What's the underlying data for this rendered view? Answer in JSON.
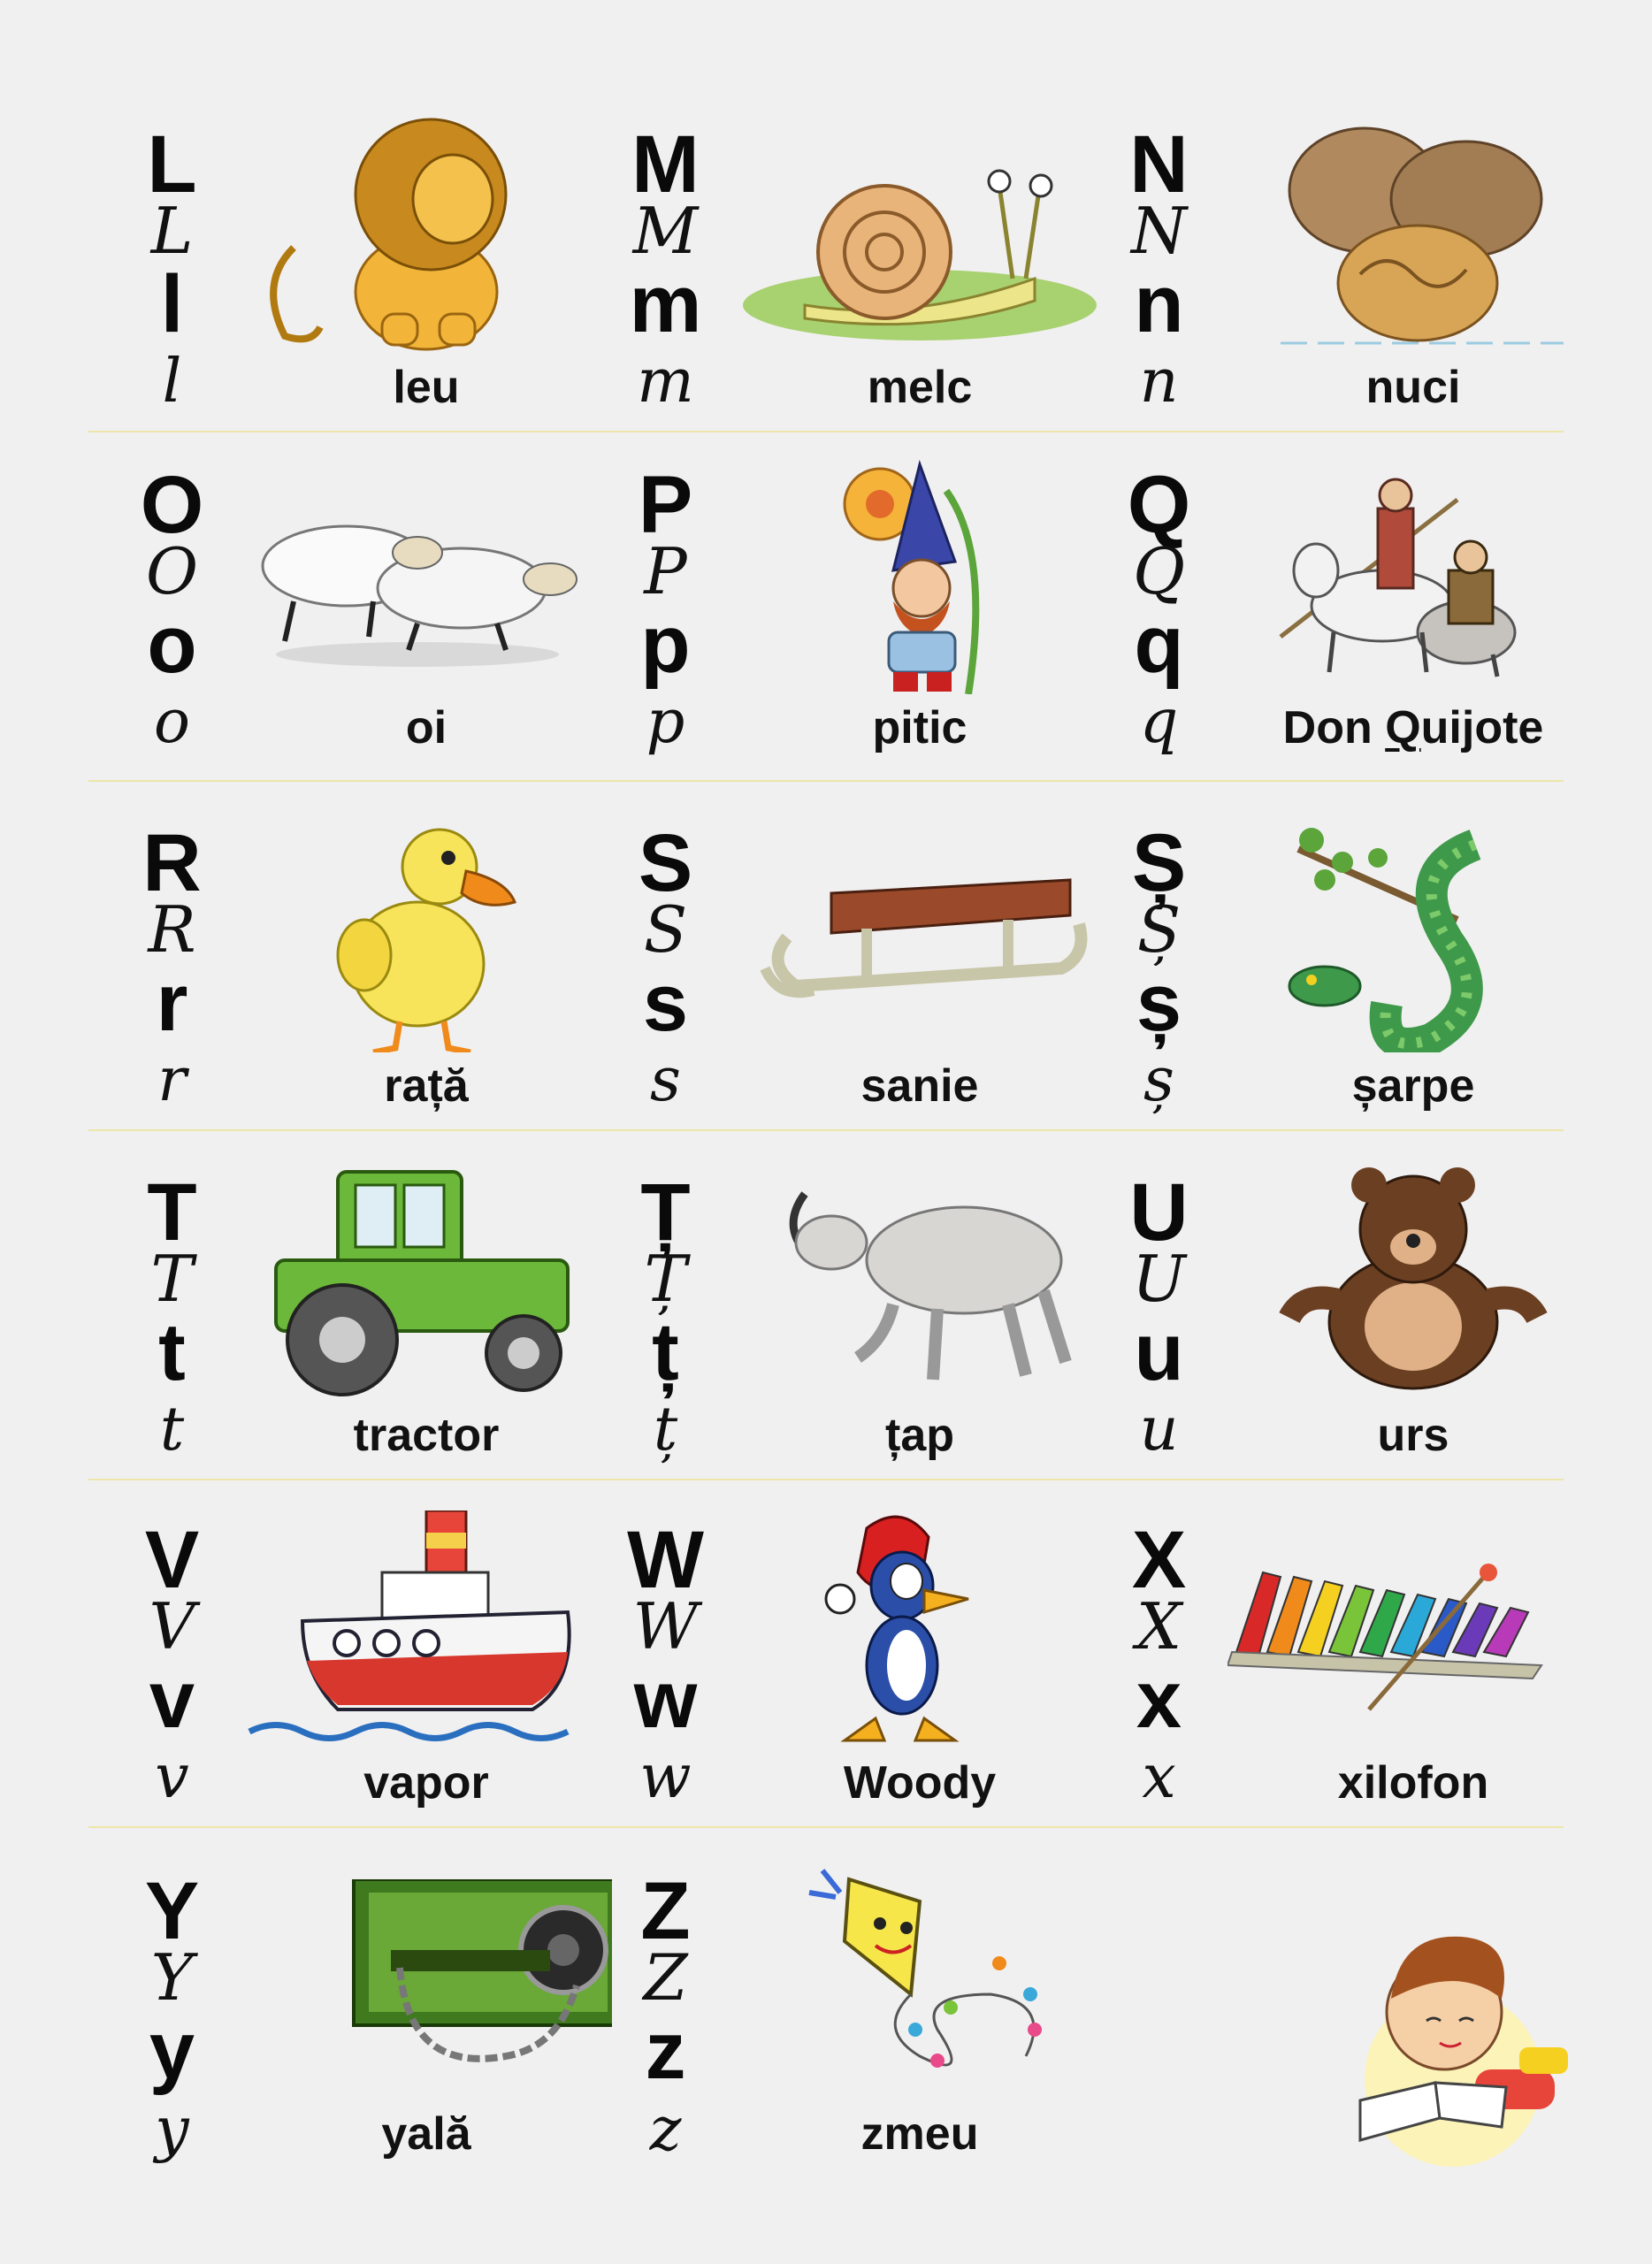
{
  "rows": [
    [
      {
        "upper": "L",
        "upper_cursive": "L",
        "lower": "l",
        "lower_cursive": "l",
        "word": "leu",
        "icon": "lion-icon"
      },
      {
        "upper": "M",
        "upper_cursive": "M",
        "lower": "m",
        "lower_cursive": "m",
        "word": "melc",
        "icon": "snail-icon"
      },
      {
        "upper": "N",
        "upper_cursive": "N",
        "lower": "n",
        "lower_cursive": "n",
        "word": "nuci",
        "icon": "walnuts-icon"
      }
    ],
    [
      {
        "upper": "O",
        "upper_cursive": "O",
        "lower": "o",
        "lower_cursive": "o",
        "word": "oi",
        "icon": "sheep-icon"
      },
      {
        "upper": "P",
        "upper_cursive": "P",
        "lower": "p",
        "lower_cursive": "p",
        "word": "pitic",
        "icon": "gnome-icon"
      },
      {
        "upper": "Q",
        "upper_cursive": "Q",
        "lower": "q",
        "lower_cursive": "q",
        "word": "Don Quijote",
        "word_pre": "Don ",
        "word_ul": "Q",
        "word_post": "uijote",
        "icon": "don-quijote-icon"
      }
    ],
    [
      {
        "upper": "R",
        "upper_cursive": "R",
        "lower": "r",
        "lower_cursive": "r",
        "word": "rață",
        "icon": "duck-icon"
      },
      {
        "upper": "S",
        "upper_cursive": "S",
        "lower": "s",
        "lower_cursive": "s",
        "word": "sanie",
        "icon": "sled-icon"
      },
      {
        "upper": "Ș",
        "upper_cursive": "Ș",
        "lower": "ș",
        "lower_cursive": "ș",
        "word": "șarpe",
        "icon": "snake-icon"
      }
    ],
    [
      {
        "upper": "T",
        "upper_cursive": "T",
        "lower": "t",
        "lower_cursive": "t",
        "word": "tractor",
        "icon": "tractor-icon"
      },
      {
        "upper": "Ț",
        "upper_cursive": "Ț",
        "lower": "ț",
        "lower_cursive": "ț",
        "word": "țap",
        "icon": "goat-icon"
      },
      {
        "upper": "U",
        "upper_cursive": "U",
        "lower": "u",
        "lower_cursive": "u",
        "word": "urs",
        "icon": "bear-icon"
      }
    ],
    [
      {
        "upper": "V",
        "upper_cursive": "V",
        "lower": "v",
        "lower_cursive": "v",
        "word": "vapor",
        "icon": "ship-icon"
      },
      {
        "upper": "W",
        "upper_cursive": "W",
        "lower": "w",
        "lower_cursive": "w",
        "word": "Woody",
        "icon": "woodpecker-icon"
      },
      {
        "upper": "X",
        "upper_cursive": "X",
        "lower": "x",
        "lower_cursive": "x",
        "word": "xilofon",
        "icon": "xylophone-icon"
      }
    ],
    [
      {
        "upper": "Y",
        "upper_cursive": "Y",
        "lower": "y",
        "lower_cursive": "y",
        "word": "yală",
        "icon": "door-lock-icon"
      },
      {
        "upper": "Z",
        "upper_cursive": "Z",
        "lower": "z",
        "lower_cursive": "z",
        "word": "zmeu",
        "icon": "kite-icon"
      },
      {
        "upper": "",
        "upper_cursive": "",
        "lower": "",
        "lower_cursive": "",
        "word": "",
        "icon": "reading-boy-icon"
      }
    ]
  ],
  "colors": {
    "background": "#f1f0f1",
    "divider": "#ece6a8"
  }
}
